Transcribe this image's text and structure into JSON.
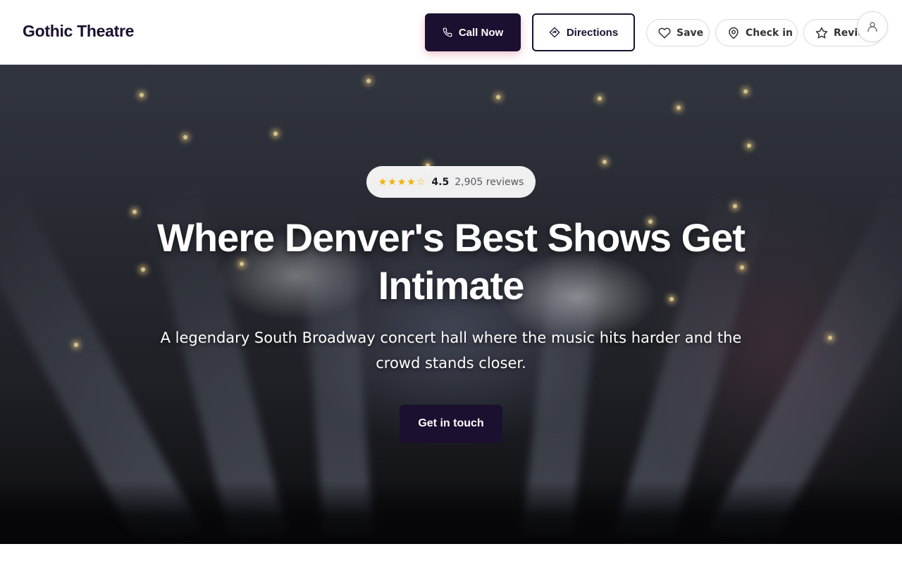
{
  "header": {
    "brand": "Gothic Theatre",
    "call_label": "Call Now",
    "directions_label": "Directions",
    "save_label": "Save",
    "checkin_label": "Check in",
    "review_label": "Review"
  },
  "hero": {
    "stars": "★★★★☆",
    "rating": "4.5",
    "reviews": "2,905 reviews",
    "headline": "Where Denver's Best Shows Get Intimate",
    "subtitle": "A legendary South Broadway concert hall where the music hits harder and the crowd stands closer.",
    "cta_label": "Get in touch"
  },
  "colors": {
    "brand": "#1c1030",
    "star": "#f4b000",
    "white": "#ffffff"
  },
  "icons": {
    "call": "phone-icon",
    "directions": "directions-icon",
    "save": "heart-icon",
    "checkin": "map-pin-icon",
    "review": "star-icon",
    "account": "user-icon"
  }
}
